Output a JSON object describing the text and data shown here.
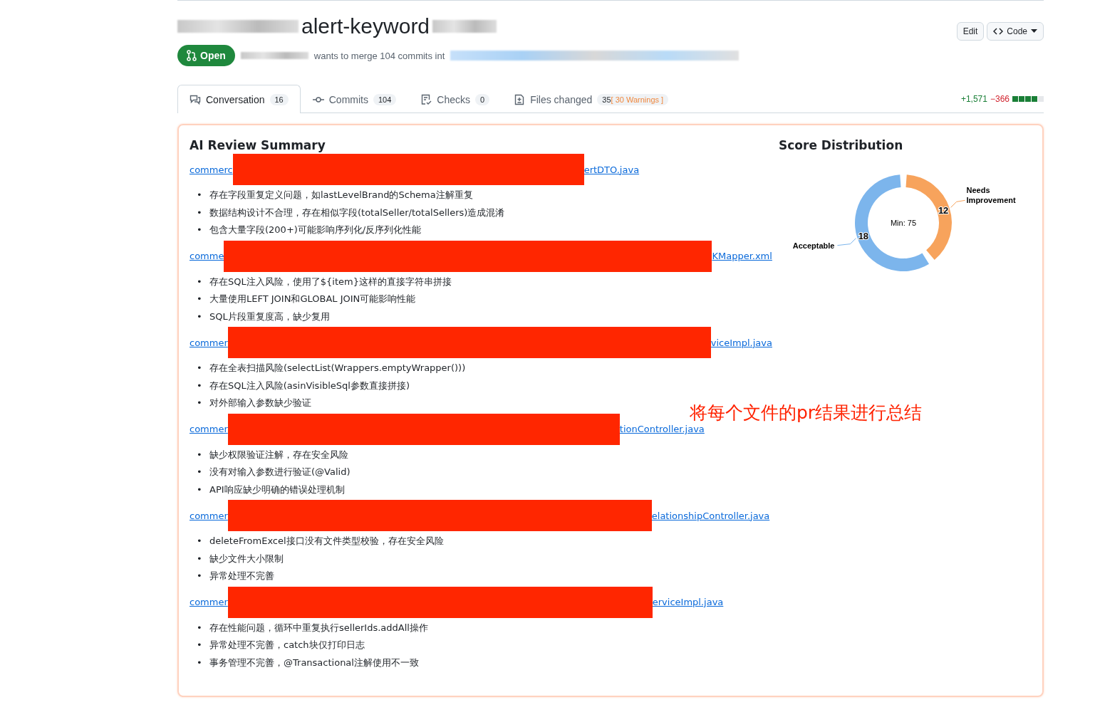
{
  "header": {
    "title": "alert-keyword",
    "actions": [
      {
        "label": "Edit",
        "kind": "plain"
      },
      {
        "label": "Code",
        "kind": "dropdown"
      }
    ],
    "status": "Open",
    "merge_text": "wants to merge 104 commits int"
  },
  "tabs": [
    {
      "label": "Conversation",
      "count": "16",
      "selected": true
    },
    {
      "label": "Commits",
      "count": "104",
      "selected": false
    },
    {
      "label": "Checks",
      "count": "0",
      "selected": false
    },
    {
      "label": "Files changed",
      "count": "35",
      "warning": "[ 30 Warnings ]",
      "selected": false
    }
  ],
  "diffstat": {
    "additions": "+1,571",
    "deletions": "−366"
  },
  "summary": {
    "title": "AI Review Summary",
    "bullet": "•",
    "files": [
      {
        "prefix": "commerc",
        "suffix": "ertDTO.java",
        "issues": [
          "存在字段重复定义问题，如lastLevelBrand的Schema注解重复",
          "数据结构设计不合理，存在相似字段(totalSeller/totalSellers)造成混淆",
          "包含大量字段(200+)可能影响序列化/反序列化性能"
        ]
      },
      {
        "prefix": "comme",
        "suffix": "KMapper.xml",
        "issues": [
          "存在SQL注入风险，使用了${item}这样的直接字符串拼接",
          "大量使用LEFT JOIN和GLOBAL JOIN可能影响性能",
          "SQL片段重复度高，缺少复用"
        ]
      },
      {
        "prefix": "commer",
        "suffix": "viceImpl.java",
        "issues": [
          "存在全表扫描风险(selectList(Wrappers.emptyWrapper()))",
          "存在SQL注入风险(asinVisibleSql参数直接拼接)",
          "对外部输入参数缺少验证"
        ]
      },
      {
        "prefix": "commer",
        "suffix": "tionController.java",
        "issues": [
          "缺少权限验证注解，存在安全风险",
          "没有对输入参数进行验证(@Valid)",
          "API响应缺少明确的错误处理机制"
        ]
      },
      {
        "prefix": "commer",
        "suffix": "elationshipController.java",
        "issues": [
          "deleteFromExcel接口没有文件类型校验，存在安全风险",
          "缺少文件大小限制",
          "异常处理不完善"
        ]
      },
      {
        "prefix": "commer",
        "suffix": "erviceImpl.java",
        "issues": [
          "存在性能问题，循环中重复执行sellerIds.addAll操作",
          "异常处理不完善，catch块仅打印日志",
          "事务管理不完善，@Transactional注解使用不一致"
        ]
      }
    ]
  },
  "distribution": {
    "title": "Score Distribution",
    "chart_data": {
      "type": "donut",
      "categories": [
        "Acceptable",
        "Needs Improvement"
      ],
      "values": [
        18,
        12
      ],
      "colors": [
        "#7cb5ec",
        "#f7a35c"
      ],
      "data_labels": true,
      "annotations": [
        "Min: 75"
      ]
    }
  },
  "annotation": "将每个文件的pr结果进行总结"
}
